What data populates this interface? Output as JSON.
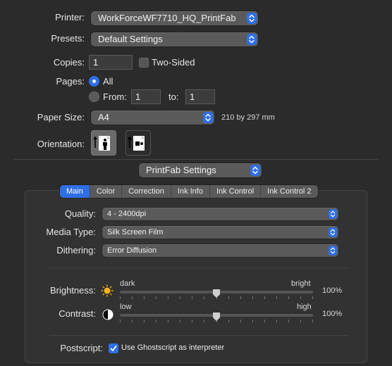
{
  "printer": {
    "label": "Printer:",
    "value": "WorkForceWF7710_HQ_PrintFab"
  },
  "presets": {
    "label": "Presets:",
    "value": "Default Settings"
  },
  "copies": {
    "label": "Copies:",
    "value": "1",
    "two_sided_label": "Two-Sided",
    "two_sided_checked": false
  },
  "pages": {
    "label": "Pages:",
    "all_label": "All",
    "from_label": "From:",
    "from_value": "1",
    "to_label": "to:",
    "to_value": "1"
  },
  "paper_size": {
    "label": "Paper Size:",
    "value": "A4",
    "dimensions": "210 by 297 mm"
  },
  "orientation": {
    "label": "Orientation:",
    "selected": "portrait"
  },
  "section_menu": {
    "value": "PrintFab Settings"
  },
  "tabs": [
    {
      "label": "Main",
      "active": true
    },
    {
      "label": "Color",
      "active": false
    },
    {
      "label": "Correction",
      "active": false
    },
    {
      "label": "Ink Info",
      "active": false
    },
    {
      "label": "Ink Control",
      "active": false
    },
    {
      "label": "Ink Control 2",
      "active": false
    }
  ],
  "main": {
    "quality": {
      "label": "Quality:",
      "value": "4 - 2400dpi"
    },
    "media_type": {
      "label": "Media Type:",
      "value": "Silk Screen Film"
    },
    "dithering": {
      "label": "Dithering:",
      "value": "Error Diffusion"
    },
    "brightness": {
      "label": "Brightness:",
      "min_label": "dark",
      "max_label": "bright",
      "value_text": "100%",
      "level": 0.5
    },
    "contrast": {
      "label": "Contrast:",
      "min_label": "low",
      "max_label": "high",
      "value_text": "100%",
      "level": 0.5
    },
    "postscript": {
      "label": "Postscript:",
      "checkbox_label": "Use Ghostscript as interpreter",
      "checked": true
    }
  },
  "colors": {
    "accent": "#2f6fe6",
    "background": "#2b2b2b",
    "control": "#5a5a5a"
  }
}
